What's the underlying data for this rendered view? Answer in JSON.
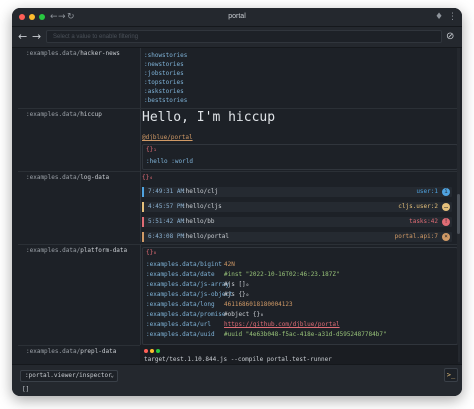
{
  "window": {
    "title": "portal"
  },
  "toolbar": {
    "back_icon": "arrow-left-icon",
    "forward_icon": "arrow-right-icon",
    "search_placeholder": "Select a value to enable filtering",
    "clear_icon": "clear-filter-icon"
  },
  "rows": [
    {
      "key_prefix": ":examples.data/",
      "key_name": "hacker-news",
      "items": [
        ":showstories",
        ":newstories",
        ":jobstories",
        ":topstories",
        ":askstories",
        ":beststories"
      ]
    },
    {
      "key_prefix": ":examples.data/",
      "key_name": "hiccup",
      "heading": "Hello, I'm hiccup",
      "link": "@djblue/portal",
      "brace": "{}₁",
      "body": ":hello :world"
    },
    {
      "key_prefix": ":examples.data/",
      "key_name": "log-data",
      "count": "{}₄",
      "logs": [
        {
          "time": "7:49:31 AM",
          "ns": ":hello/clj",
          "loc": "user:1",
          "color": "#4fa3e0"
        },
        {
          "time": "4:45:57 PM",
          "ns": ":hello/cljs",
          "loc": "cljs.user:2",
          "color": "#e5c07b"
        },
        {
          "time": "5:51:42 AM",
          "ns": ":hello/bb",
          "loc": "tasks:42",
          "color": "#e06c75"
        },
        {
          "time": "6:43:08 PM",
          "ns": ":hello/portal",
          "loc": "portal.api:7",
          "color": "#d19a66"
        }
      ]
    },
    {
      "key_prefix": ":examples.data/",
      "key_name": "platform-data",
      "count": "{}₈",
      "entries": [
        {
          "k": ":examples.data/bigint",
          "v": "42N"
        },
        {
          "k": ":examples.data/date",
          "v": "#inst \"2022-10-16T02:46:23.187Z\""
        },
        {
          "k": ":examples.data/js-array",
          "v": "#js []₀"
        },
        {
          "k": ":examples.data/js-object",
          "v": "#js {}₀"
        },
        {
          "k": ":examples.data/long",
          "v": "4611686018180004123"
        },
        {
          "k": ":examples.data/promise",
          "v": "#object {}₀"
        },
        {
          "k": ":examples.data/url",
          "v": "https://github.com/djblue/portal"
        },
        {
          "k": ":examples.data/uuid",
          "v": "#uuid \"4e63b048-f5ac-418e-a31d-d5952487784b7\""
        }
      ]
    },
    {
      "key_prefix": ":examples.data/",
      "key_name": "prepl-data",
      "terminal_text": "target/test.1.10.844.js --compile portal.test-runner"
    }
  ],
  "bottom": {
    "viewer": ":portal.viewer/inspector",
    "value": "[]",
    "terminal_icon": "terminal-icon"
  }
}
